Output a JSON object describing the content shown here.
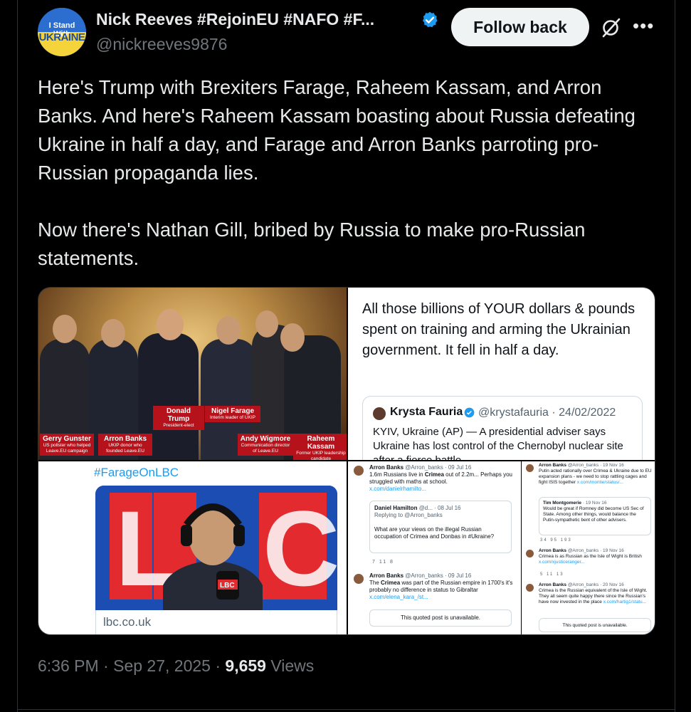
{
  "author": {
    "avatar_text_top": "I Stand With",
    "avatar_text_bottom": "UKRAINE",
    "display_name": "Nick Reeves #RejoinEU #NAFO #F...",
    "handle": "@nickreeves9876",
    "verified_color": "#1d9bf0"
  },
  "actions": {
    "follow_label": "Follow back",
    "grok_icon": "grok-icon",
    "more_icon": "more-icon"
  },
  "post": {
    "paragraph_1": "Here's Trump with Brexiters Farage, Raheem Kassam, and Arron Banks. And here's Raheem Kassam boasting about Russia defeating Ukraine in half a day, and Farage and Arron Banks parroting pro-Russian propaganda lies.",
    "paragraph_2": "Now there's Nathan Gill, bribed by Russia to make pro-Russian statements."
  },
  "media": {
    "photo_captions": [
      {
        "name": "Gerry Gunster",
        "role": "US pollster who helped Leave.EU campaign"
      },
      {
        "name": "Arron Banks",
        "role": "UKIP donor who founded Leave.EU"
      },
      {
        "name": "Donald Trump",
        "role": "President-elect"
      },
      {
        "name": "Nigel Farage",
        "role": "Interim leader of UKIP"
      },
      {
        "name": "Andy Wigmore",
        "role": "Communication director of Leave.EU"
      },
      {
        "name": "Raheem Kassam",
        "role": "Former UKIP leadership candidate"
      }
    ],
    "tweet_card": {
      "text": "All those billions of YOUR dollars & pounds spent on training and arming the Ukrainian government. It fell in half a day.",
      "quoted_name": "Krysta Fauria",
      "quoted_meta": "@krystafauria · 24/02/2022",
      "quoted_text": "KYIV, Ukraine (AP) — A presidential adviser says Ukraine has lost control of the Chernobyl nuclear site after a fierce battle"
    },
    "lbc": {
      "hashtag": "#FarageOnLBC",
      "link": "lbc.co.uk",
      "logo_text": "LBC"
    },
    "collage": {
      "t1_name": "Arron Banks",
      "t1_meta": "@Arron_banks · 09 Jul 16",
      "t1_text_a": "1.6m Russians live in ",
      "t1_bold": "Crimea",
      "t1_text_b": " out of 2.2m... Perhaps you struggled with maths at school.",
      "t1_link": "x.com/danielrhamilto...",
      "q1_name": "Daniel Hamilton",
      "q1_meta": "@d... · 08 Jul 16",
      "q1_reply": "Replying to @Arron_banks",
      "q1_text": "What are your views on the illegal Russian occupation of Crimea and Donbas in #Ukraine?",
      "t2_name": "Arron Banks",
      "t2_meta": "@Arron_banks · 09 Jul 16",
      "t2_text_a": "The ",
      "t2_bold": "Crimea",
      "t2_text_b": " was part of the Russian empire in 1700's it's probably no difference in status to Gibraltar",
      "t2_link": "x.com/elena_kara_/st...",
      "unavailable": "This quoted post is unavailable.",
      "r1_name": "Arron Banks",
      "r1_meta": "@Arron_banks · 19 Nov 16",
      "r1_text": "Putin acted rationally over Crimea & Ukraine due to EU expansion plans - we need to stop rattling cages and fight ISIS together",
      "r1_link": "x.com/montie/status/...",
      "r2_name": "Tim Montgomerie",
      "r2_meta": "· 19 Nov 16",
      "r2_text": "Would be great if Romney did become US Sec of State. Among other things, would balance the Putin-sympathetic bent of other advisers.",
      "r3_name": "Arron Banks",
      "r3_meta": "@Arron_banks · 19 Nov 16",
      "r3_text": "Crimea is as Russian as the Isle of Wight is British",
      "r3_link": "x.com/xjusticeranger...",
      "r4_name": "Arron Banks",
      "r4_meta": "@Arron_banks · 20 Nov 16",
      "r4_text": "Crimea is the Russian equivalent of the Isle of Wight. They all seem quite happy there since the Russian's have now invested in the place",
      "r4_link": "x.com/hartig1/statu...",
      "r_unavailable": "This quoted post is unavailable.",
      "action_counts_1": "7   11   8",
      "action_counts_2": "34   95   193",
      "action_counts_3": "5   11   13"
    }
  },
  "footer": {
    "time": "6:36 PM",
    "date": "Sep 27, 2025",
    "views_count": "9,659",
    "views_label": "Views",
    "separator": "·"
  }
}
